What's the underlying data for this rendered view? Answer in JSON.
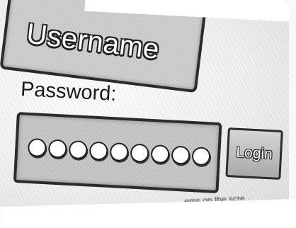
{
  "username_field": {
    "text": "Username"
  },
  "password_label": "Password:",
  "password_field": {
    "masked_char_count": 9
  },
  "login_button": {
    "label": "Login"
  },
  "footer": {
    "text": "...ems on the scre..."
  }
}
